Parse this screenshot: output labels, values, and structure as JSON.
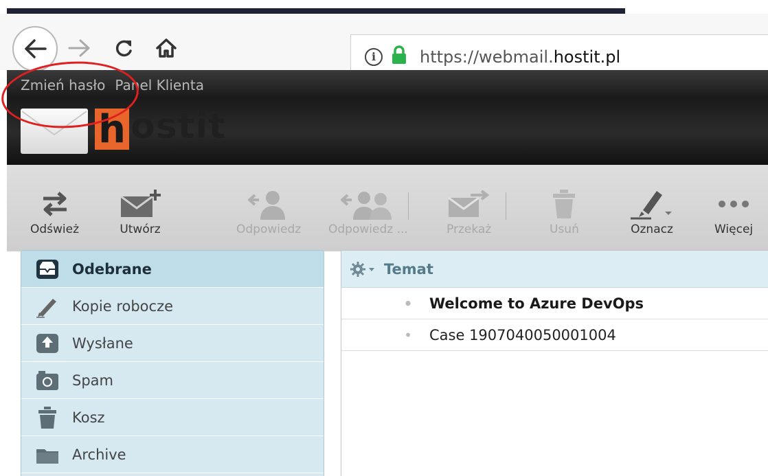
{
  "browser": {
    "url_prefix": "https://webmail.",
    "url_host": "hostit.pl",
    "info_glyph": "i"
  },
  "header": {
    "links": [
      "Zmień hasło",
      "Panel Klienta"
    ],
    "logo_first": "h",
    "logo_rest": "ostit"
  },
  "toolbar": {
    "buttons": [
      {
        "label": "Odśwież",
        "icon": "refresh-icon",
        "enabled": true
      },
      {
        "label": "Utwórz",
        "icon": "compose-icon",
        "enabled": true
      },
      {
        "label": "Odpowiedz",
        "icon": "reply-icon",
        "enabled": false
      },
      {
        "label": "Odpowiedz ...",
        "icon": "reply-all-icon",
        "enabled": false
      },
      {
        "label": "Przekaż",
        "icon": "forward-icon",
        "enabled": false
      },
      {
        "label": "Usuń",
        "icon": "trash-icon",
        "enabled": false
      },
      {
        "label": "Oznacz",
        "icon": "mark-icon",
        "enabled": true
      },
      {
        "label": "Więcej",
        "icon": "more-icon",
        "enabled": true
      }
    ]
  },
  "folders": [
    {
      "label": "Odebrane",
      "icon": "inbox-icon",
      "active": true
    },
    {
      "label": "Kopie robocze",
      "icon": "pencil-icon",
      "active": false
    },
    {
      "label": "Wysłane",
      "icon": "sent-icon",
      "active": false
    },
    {
      "label": "Spam",
      "icon": "spam-icon",
      "active": false
    },
    {
      "label": "Kosz",
      "icon": "trash-icon",
      "active": false
    },
    {
      "label": "Archive",
      "icon": "archive-icon",
      "active": false
    }
  ],
  "messages": {
    "column_header": "Temat",
    "rows": [
      {
        "subject": "Welcome to Azure DevOps",
        "unread": true,
        "bullet": "•"
      },
      {
        "subject": "Case 1907040050001004",
        "unread": false,
        "bullet": "•"
      }
    ]
  },
  "colors": {
    "accent_orange": "#e8652c",
    "annotation_red": "#e02020",
    "folder_bg": "#d6e9f0",
    "lock_green": "#2bb24c"
  }
}
